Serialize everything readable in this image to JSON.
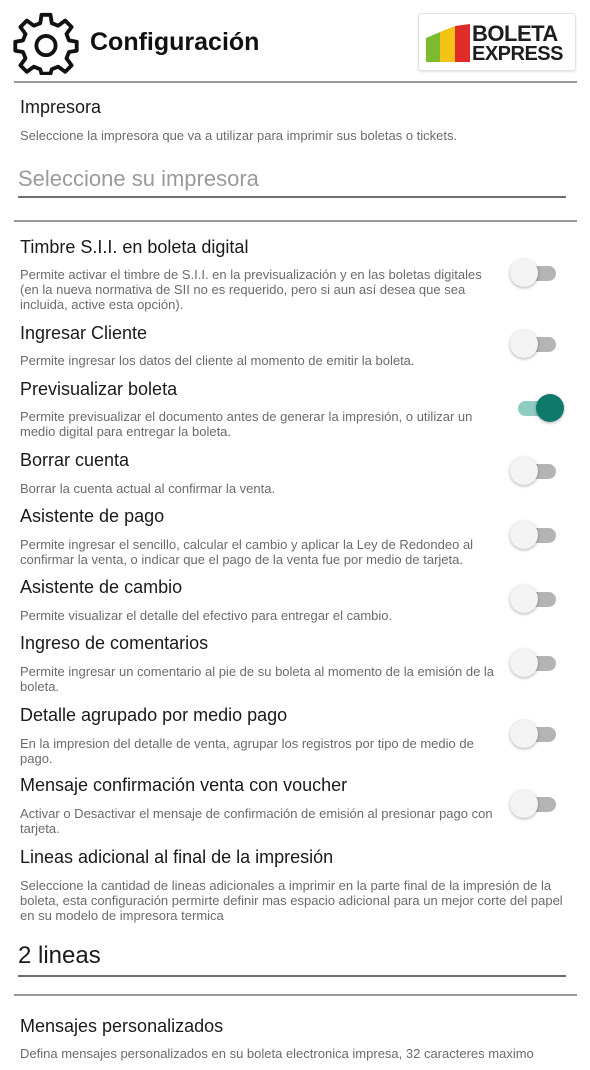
{
  "header": {
    "title": "Configuración",
    "logo_line1": "BOLETA",
    "logo_line2": "EXPRESS",
    "icon": "gear-icon"
  },
  "printer": {
    "title": "Impresora",
    "description": "Seleccione la impresora que va a utilizar para imprimir sus boletas o tickets.",
    "placeholder": "Seleccione su impresora"
  },
  "settings": [
    {
      "title": "Timbre S.I.I. en boleta digital",
      "description": "Permite activar el timbre de S.I.I. en la previsualización y en las boletas digitales (en la nueva normativa de SII no es requerido, pero si aun así desea que sea incluida, active esta opción).",
      "enabled": false
    },
    {
      "title": "Ingresar Cliente",
      "description": "Permite ingresar los datos del cliente al momento de emitir la boleta.",
      "enabled": false
    },
    {
      "title": "Previsualizar boleta",
      "description": "Permite previsualizar el documento antes de generar la impresión, o utilizar un medio digital para entregar la boleta.",
      "enabled": true
    },
    {
      "title": "Borrar cuenta",
      "description": "Borrar la cuenta actual al confirmar la venta.",
      "enabled": false
    },
    {
      "title": "Asistente de pago",
      "description": "Permite ingresar el sencillo, calcular el cambio y aplicar la Ley de Redondeo al confirmar la venta, o indicar que el pago de la venta fue por medio de tarjeta.",
      "enabled": false
    },
    {
      "title": "Asistente de cambio",
      "description": "Permite visualizar el detalle del efectivo para entregar el cambio.",
      "enabled": false
    },
    {
      "title": "Ingreso de comentarios",
      "description": "Permite ingresar un comentario al pie de su boleta al momento de la emisión de la boleta.",
      "enabled": false
    },
    {
      "title": "Detalle agrupado por medio pago",
      "description": "En la impresion del detalle de venta, agrupar los registros por tipo de medio de pago.",
      "enabled": false
    },
    {
      "title": "Mensaje confirmación venta con voucher",
      "description": "Activar o Desactivar el mensaje de confirmación de emisión al presionar pago con tarjeta.",
      "enabled": false
    }
  ],
  "extra_lines": {
    "title": "Lineas adicional al final de la impresión",
    "description": "Seleccione la cantidad de lineas adicionales a imprimir en la parte final de la impresión de la boleta, esta configuración permirte definir mas espacio adicional para un mejor corte del papel en su modelo de impresora termica",
    "value": "2 lineas"
  },
  "custom_messages": {
    "title": "Mensajes personalizados",
    "description": "Defina mensajes personalizados en su boleta electronica impresa, 32 caracteres maximo"
  }
}
